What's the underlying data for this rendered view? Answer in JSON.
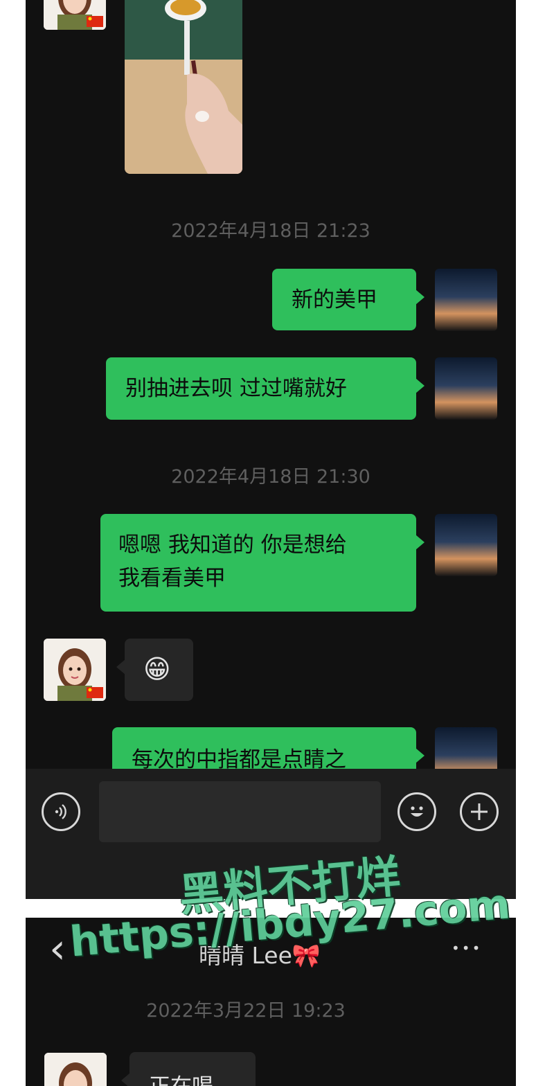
{
  "chat1": {
    "timestamps": [
      "2022年4月18日 21:23",
      "2022年4月18日 21:30"
    ],
    "messages": [
      {
        "text": "新的美甲"
      },
      {
        "text": "别抽进去呗 过过嘴就好"
      },
      {
        "text_line1": "嗯嗯 我知道的 你是想给",
        "text_line2": "我看看美甲"
      },
      {
        "emoji": "😁"
      },
      {
        "text": "每次的中指都是点睛之"
      }
    ],
    "input": {
      "placeholder": ""
    }
  },
  "chat2": {
    "contact_name": "晴晴 Lee🎀",
    "timestamp": "2022年3月22日 19:23",
    "first_message": "正在喝"
  },
  "watermark": {
    "line1": "黑料不打烊",
    "line2": "https://ibdy27.com"
  },
  "icons": {
    "back": "‹",
    "more": "•••",
    "voice": "voice-icon",
    "emoji": "emoji-icon",
    "plus": "plus-icon"
  },
  "colors": {
    "chat_background": "#111111",
    "sent_bubble": "#2fbf5c",
    "received_bubble": "#262626",
    "timestamp": "#5f5f5f",
    "watermark": "#5fcf9a"
  }
}
